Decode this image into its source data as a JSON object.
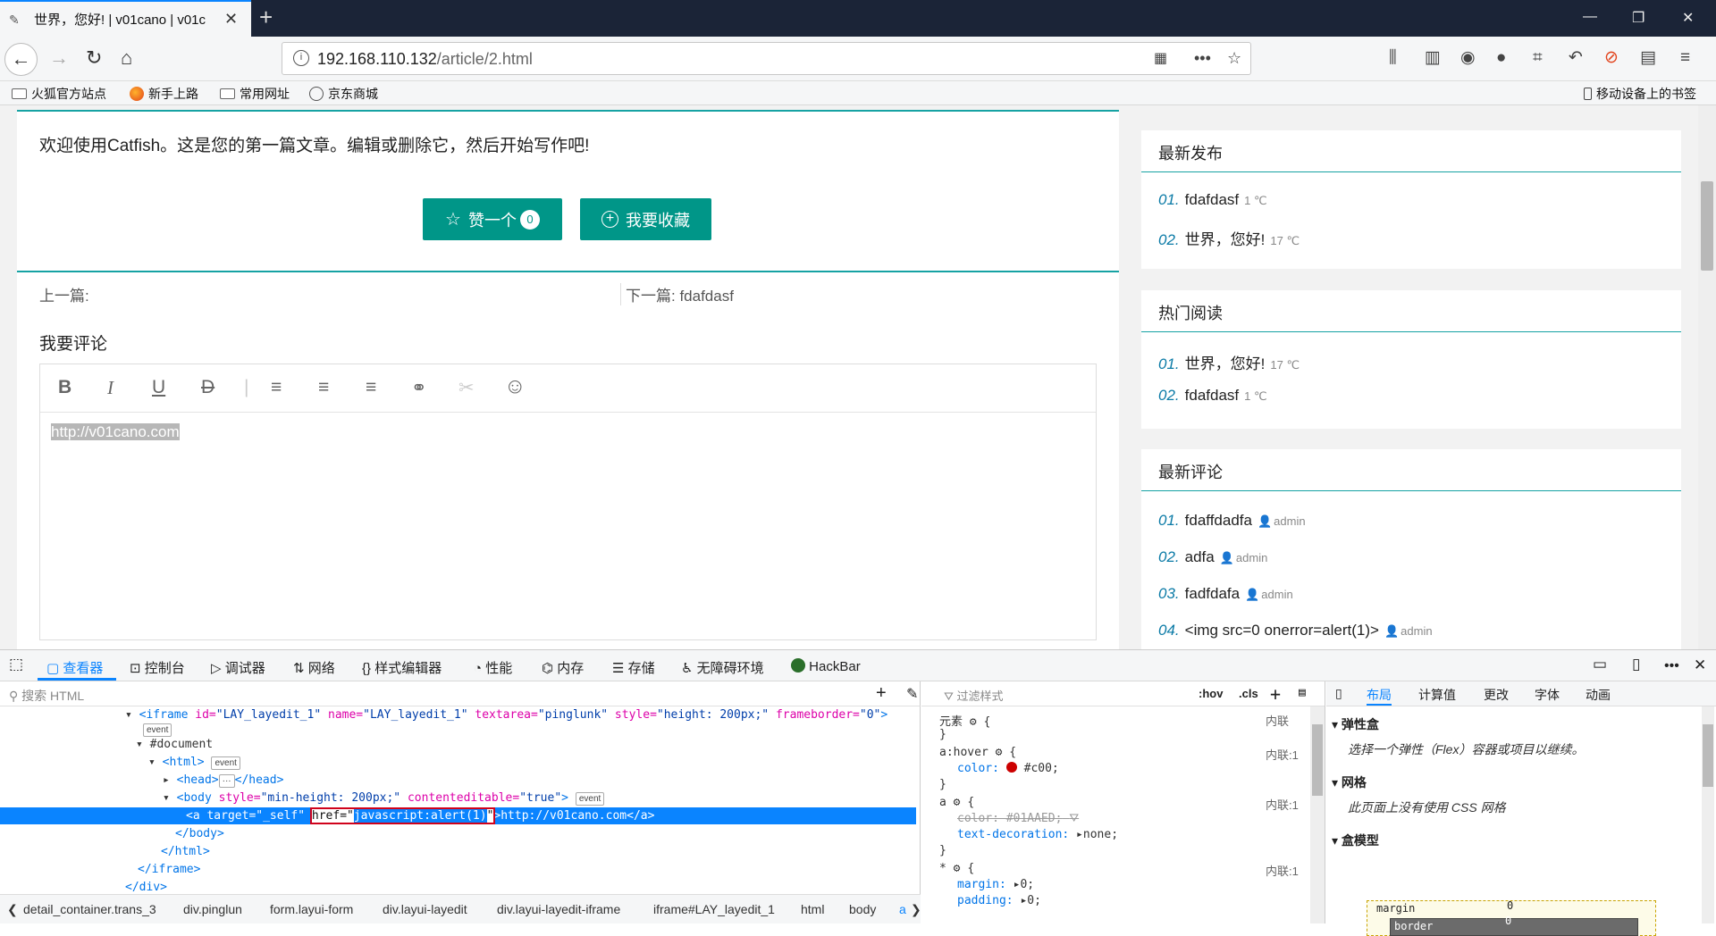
{
  "browser": {
    "tab_title": "世界，您好! | v01cano | v01c",
    "url_host": "192.168.110.132",
    "url_path": "/article/2.html",
    "bookmarks": [
      "火狐官方站点",
      "新手上路",
      "常用网址",
      "京东商城"
    ],
    "mobile_bookmarks": "移动设备上的书签"
  },
  "article": {
    "welcome_text": "欢迎使用Catfish。这是您的第一篇文章。编辑或删除它，然后开始写作吧!",
    "like_label": "赞一个",
    "like_count": "0",
    "favorite_label": "我要收藏",
    "prev_label": "上一篇:",
    "next_label": "下一篇: fdafdasf",
    "comment_heading": "我要评论",
    "editor_text": "http://v01cano.com"
  },
  "sidebar": {
    "latest": {
      "title": "最新发布",
      "items": [
        {
          "num": "01.",
          "text": "fdafdasf",
          "meta": "1 ℃"
        },
        {
          "num": "02.",
          "text": "世界，您好!",
          "meta": "17 ℃"
        }
      ]
    },
    "hot": {
      "title": "热门阅读",
      "items": [
        {
          "num": "01.",
          "text": "世界，您好!",
          "meta": "17 ℃"
        },
        {
          "num": "02.",
          "text": "fdafdasf",
          "meta": "1 ℃"
        }
      ]
    },
    "comments": {
      "title": "最新评论",
      "items": [
        {
          "num": "01.",
          "text": "fdaffdadfa",
          "meta": "admin"
        },
        {
          "num": "02.",
          "text": "adfa",
          "meta": "admin"
        },
        {
          "num": "03.",
          "text": "fadfdafa",
          "meta": "admin"
        },
        {
          "num": "04.",
          "text": "<img src=0 onerror=alert(1)>",
          "meta": "admin"
        }
      ]
    }
  },
  "devtools": {
    "tabs": [
      "查看器",
      "控制台",
      "调试器",
      "网络",
      "样式编辑器",
      "性能",
      "内存",
      "存储",
      "无障碍环境",
      "HackBar"
    ],
    "search_placeholder": "搜索 HTML",
    "filter_placeholder": "过滤样式",
    "hov": ":hov",
    "cls": ".cls",
    "event": "event",
    "tree": {
      "l1_a": "<iframe ",
      "l1_b": "id=",
      "l1_c": "\"LAY_layedit_1\"",
      "l1_d": " name=",
      "l1_e": "\"LAY_layedit_1\"",
      "l1_f": " textarea=",
      "l1_g": "\"pinglunk\"",
      "l1_h": " style=",
      "l1_i": "\"height: 200px;\"",
      "l1_j": " frameborder=",
      "l1_k": "\"0\"",
      "l1_l": ">",
      "l2": "#document",
      "l3": "<html>",
      "l4": "<head>",
      "l4_dots": "···",
      "l4_end": "</head>",
      "l5_a": "<body ",
      "l5_b": "style=",
      "l5_c": "\"min-height: 200px;\"",
      "l5_d": " contenteditable=",
      "l5_e": "\"true\"",
      "l5_f": ">",
      "l6_a": "<a target=\"_self\" ",
      "l6_b": "href=\"",
      "l6_c": "javascript:alert(1)",
      "l6_d": "\"",
      "l6_e": ">http://v01cano.com</a>",
      "l7": "</body>",
      "l8": "</html>",
      "l9": "</iframe>",
      "l10": "</div>"
    },
    "crumbs": [
      "detail_container.trans_3",
      "div.pinglun",
      "form.layui-form",
      "div.layui-layedit",
      "div.layui-layedit-iframe",
      "iframe#LAY_layedit_1",
      "html",
      "body",
      "a"
    ],
    "rules": {
      "element": "元素",
      "inline": "内联",
      "inline1": "内联:1",
      "hover_sel": "a:hover",
      "color_prop": "color:",
      "color_val": "#c00;",
      "a_sel": "a",
      "a_color": "color: #01AAED;",
      "td_prop": "text-decoration:",
      "td_val": "none;",
      "star_sel": "*",
      "margin": "margin:",
      "margin_val": "0;",
      "padding": "padding:",
      "padding_val": "0;",
      "brace_open": "{",
      "brace_close": "}"
    },
    "layout_tabs": [
      "布局",
      "计算值",
      "更改",
      "字体",
      "动画"
    ],
    "flex_title": "弹性盒",
    "flex_desc": "选择一个弹性（Flex）容器或项目以继续。",
    "grid_title": "网格",
    "grid_desc": "此页面上没有使用 CSS 网格",
    "box_title": "盒模型",
    "bm_margin": "margin",
    "bm_border": "border",
    "bm_zero": "0"
  },
  "colors": {
    "accent": "#009688",
    "teal_line": "#16a2a3",
    "devtools_blue": "#0a84ff",
    "highlight_red": "#d0021b"
  }
}
